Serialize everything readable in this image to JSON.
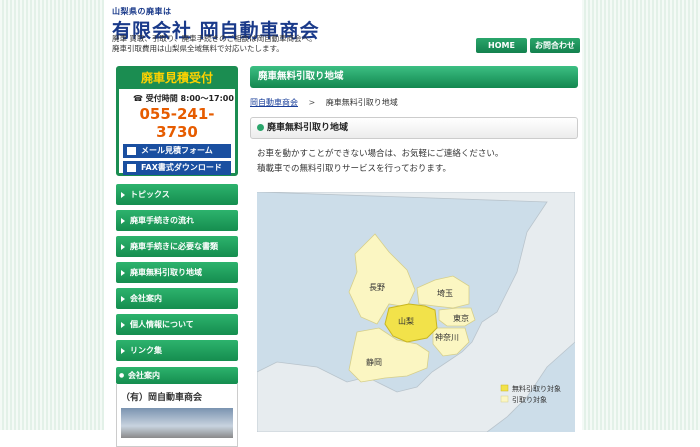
{
  "header": {
    "logo_small": "山梨県の廃車は",
    "logo_big": "有限会社 岡自動車商会",
    "tagline_1": "廃車 買取、引取り、廃車手続きのご相談は岡自動車商会へ。",
    "tagline_2": "廃車引取費用は山梨県全域無料で対応いたします。",
    "nav": [
      "HOME",
      "お問合わせ"
    ]
  },
  "sidebar": {
    "estimate_title": "廃車見積受付",
    "hours": "受付時間 8:00～17:00",
    "phone": "055-241-3730",
    "mail_button": "メール見積フォーム",
    "fax_button": "FAX書式ダウンロード",
    "menu": [
      "トピックス",
      "廃車手続きの流れ",
      "廃車手続きに必要な書類",
      "廃車無料引取り地域",
      "会社案内",
      "個人情報について",
      "リンク集"
    ],
    "company_heading": "会社案内",
    "company_name": "（有）岡自動車商会"
  },
  "main": {
    "title": "廃車無料引取り地域",
    "breadcrumb_home": "岡自動車商会",
    "breadcrumb_sep": ">",
    "breadcrumb_current": "廃車無料引取り地域",
    "section_title": "廃車無料引取り地域",
    "text_1": "お車を動かすことができない場合は、お気軽にご連絡ください。",
    "text_2": "積載車での無料引取りサービスを行っております。"
  },
  "map": {
    "labels": {
      "nagano": "長野",
      "saitama": "埼玉",
      "yamanashi": "山梨",
      "tokyo": "東京",
      "kanagawa": "神奈川",
      "shizuoka": "静岡"
    },
    "legend": {
      "free": "無料引取り対象",
      "pickup": "引取り対象"
    },
    "colors": {
      "free": "#f2e24a",
      "pickup": "#fbf6c2",
      "sea": "#ccdde9",
      "land": "#e7ecef"
    }
  }
}
